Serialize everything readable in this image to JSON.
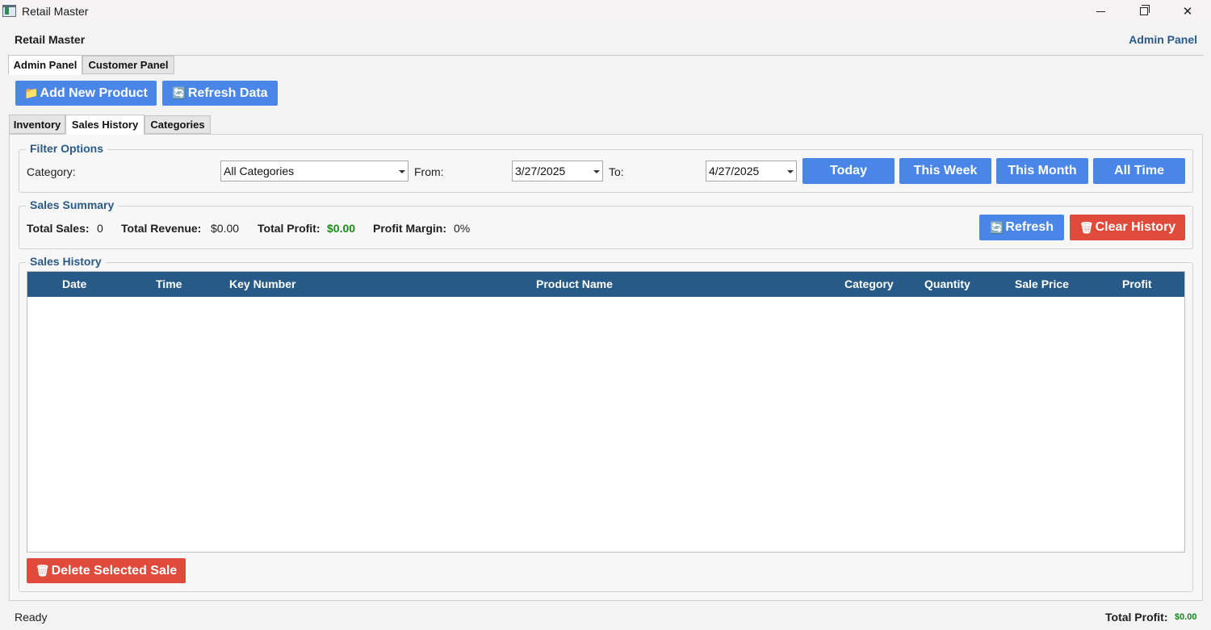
{
  "window": {
    "title": "Retail Master"
  },
  "header": {
    "title": "Retail Master",
    "panel_name": "Admin Panel"
  },
  "outer_tabs": [
    {
      "label": "Admin Panel",
      "active": true
    },
    {
      "label": "Customer Panel",
      "active": false
    }
  ],
  "toolbar": {
    "add_label": "Add New Product",
    "refresh_label": "Refresh Data"
  },
  "inner_tabs": [
    {
      "label": "Inventory",
      "active": false
    },
    {
      "label": "Sales History",
      "active": true
    },
    {
      "label": "Categories",
      "active": false
    }
  ],
  "filter": {
    "group_label": "Filter Options",
    "category_label": "Category:",
    "category_value": "All Categories",
    "from_label": "From:",
    "from_value": "3/27/2025",
    "to_label": "To:",
    "to_value": "4/27/2025",
    "today_label": "Today",
    "week_label": "This Week",
    "month_label": "This Month",
    "alltime_label": "All Time"
  },
  "summary": {
    "group_label": "Sales Summary",
    "total_sales_label": "Total Sales:",
    "total_sales_value": "0",
    "total_revenue_label": "Total Revenue:",
    "total_revenue_value": "$0.00",
    "total_profit_label": "Total Profit:",
    "total_profit_value": "$0.00",
    "profit_margin_label": "Profit Margin:",
    "profit_margin_value": "0%",
    "refresh_label": "Refresh",
    "clear_label": "Clear History"
  },
  "history": {
    "group_label": "Sales History",
    "columns": [
      "Date",
      "Time",
      "Key Number",
      "Product Name",
      "Category",
      "Quantity",
      "Sale Price",
      "Profit"
    ],
    "rows": [],
    "delete_label": "Delete Selected Sale"
  },
  "status": {
    "text": "Ready",
    "total_profit_label": "Total Profit:",
    "total_profit_value": "$0.00"
  },
  "colors": {
    "accent_blue": "#4a86e8",
    "danger_red": "#e04a3b",
    "header_navy": "#285a87",
    "profit_green": "#1a8a1a"
  }
}
